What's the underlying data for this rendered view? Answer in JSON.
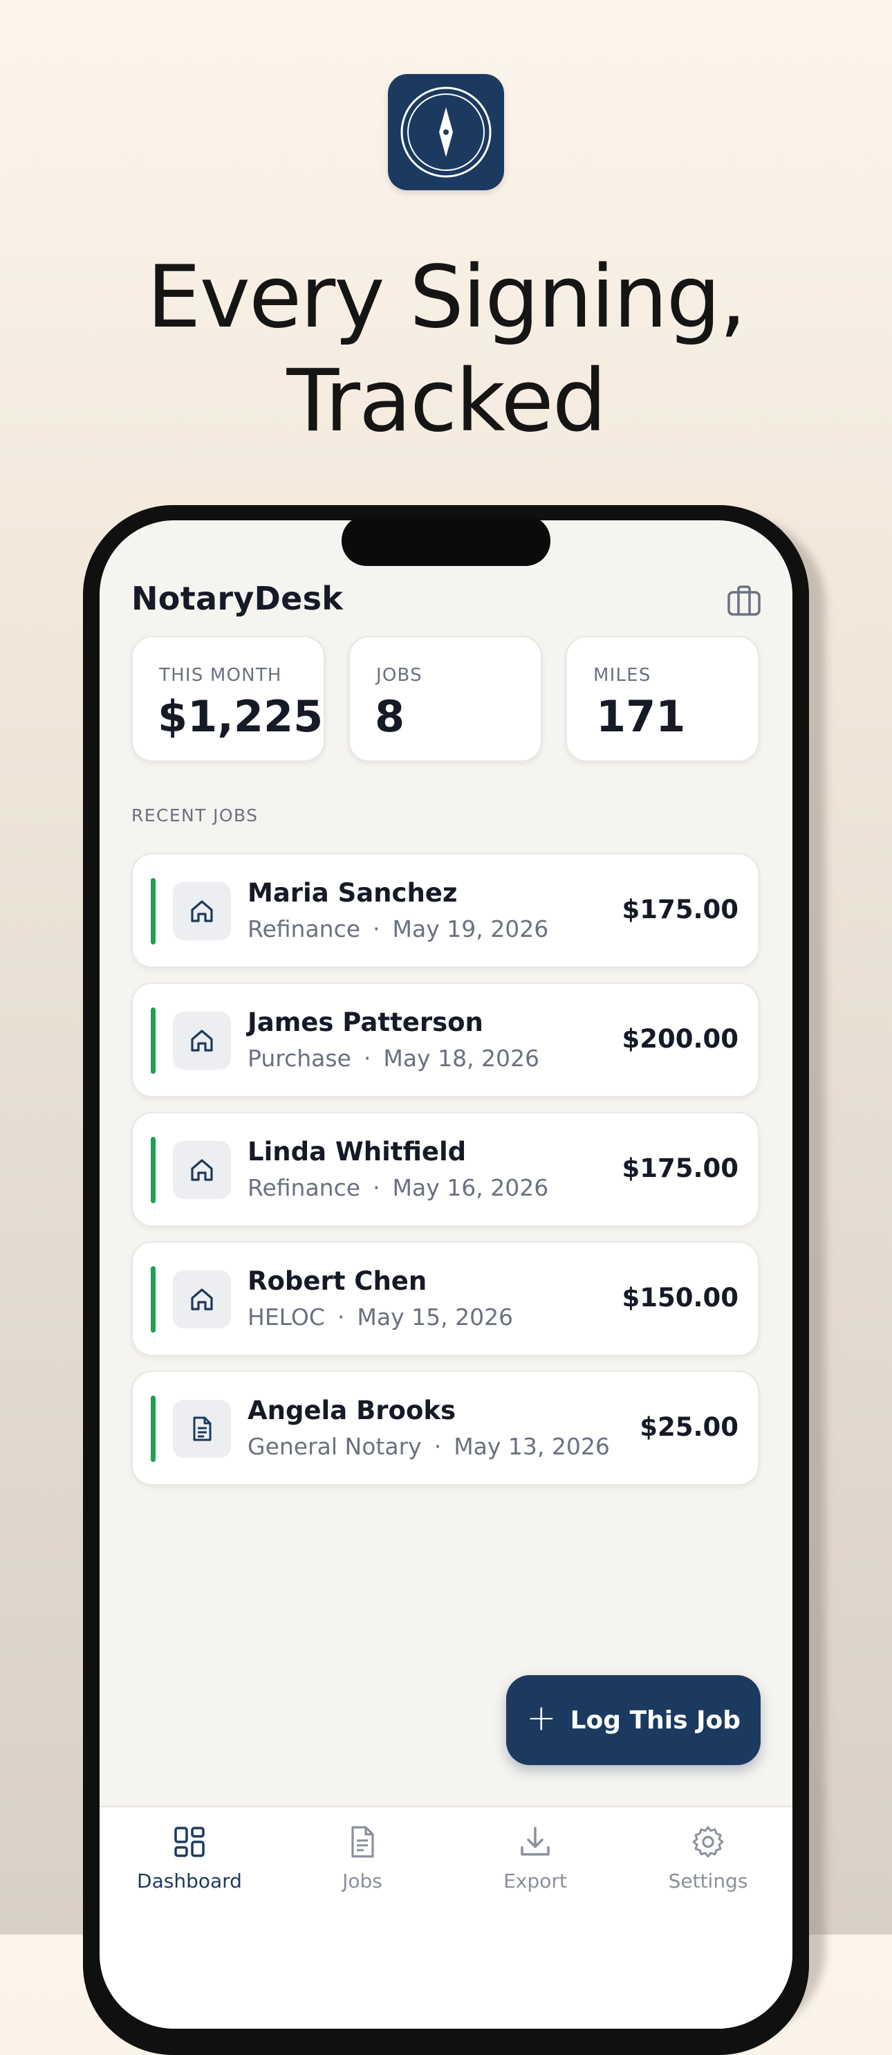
{
  "hero": {
    "headline_line1": "Every Signing,",
    "headline_line2": "Tracked"
  },
  "app": {
    "title": "NotaryDesk",
    "header_icon": "briefcase-icon"
  },
  "stats": [
    {
      "label": "THIS MONTH",
      "value": "$1,225"
    },
    {
      "label": "JOBS",
      "value": "8"
    },
    {
      "label": "MILES",
      "value": "171"
    }
  ],
  "recent_jobs": {
    "section_label": "RECENT JOBS",
    "items": [
      {
        "name": "Maria Sanchez",
        "type": "Refinance",
        "date": "May 19, 2026",
        "amount": "$175.00",
        "icon": "home-icon"
      },
      {
        "name": "James Patterson",
        "type": "Purchase",
        "date": "May 18, 2026",
        "amount": "$200.00",
        "icon": "home-icon"
      },
      {
        "name": "Linda Whitfield",
        "type": "Refinance",
        "date": "May 16, 2026",
        "amount": "$175.00",
        "icon": "home-icon"
      },
      {
        "name": "Robert Chen",
        "type": "HELOC",
        "date": "May 15, 2026",
        "amount": "$150.00",
        "icon": "home-icon"
      },
      {
        "name": "Angela Brooks",
        "type": "General Notary",
        "date": "May 13, 2026",
        "amount": "$25.00",
        "icon": "document-icon"
      }
    ],
    "separator": "·"
  },
  "fab": {
    "label": "Log This Job",
    "icon": "plus-icon"
  },
  "tabbar": {
    "tabs": [
      {
        "label": "Dashboard",
        "icon": "dashboard-icon",
        "active": true
      },
      {
        "label": "Jobs",
        "icon": "document-icon",
        "active": false
      },
      {
        "label": "Export",
        "icon": "download-icon",
        "active": false
      },
      {
        "label": "Settings",
        "icon": "gear-icon",
        "active": false
      }
    ]
  },
  "colors": {
    "brand_navy": "#1c3a5f",
    "accent_green": "#1ea052",
    "text_primary": "#161a26",
    "text_secondary": "#6a7180"
  }
}
